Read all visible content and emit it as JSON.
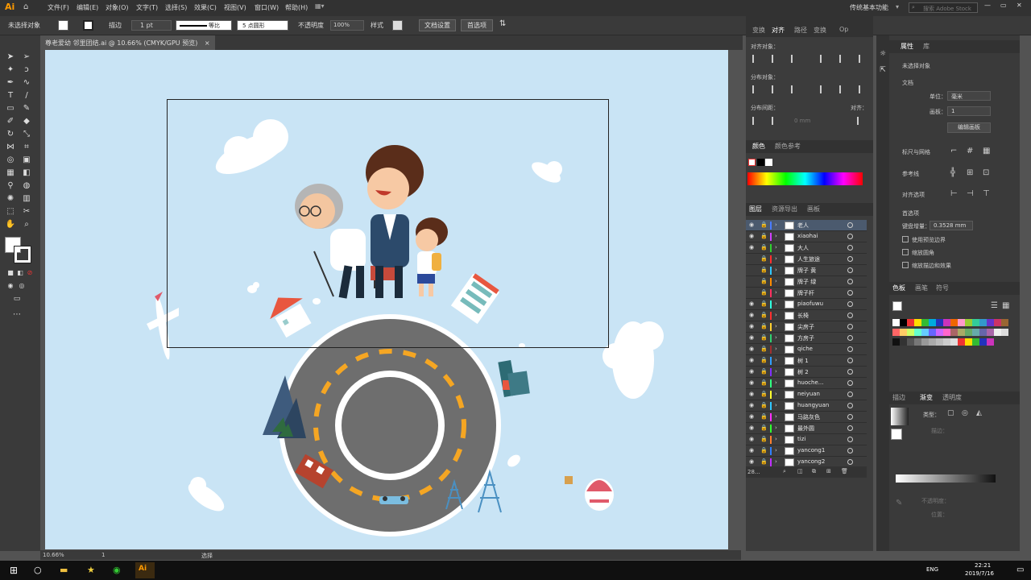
{
  "menubar": {
    "logo": "Ai",
    "items": [
      "文件(F)",
      "编辑(E)",
      "对象(O)",
      "文字(T)",
      "选择(S)",
      "效果(C)",
      "视图(V)",
      "窗口(W)",
      "帮助(H)"
    ],
    "workspace": "传统基本功能",
    "search_placeholder": "搜索 Adobe Stock"
  },
  "control": {
    "no_selection": "未选择对象",
    "stroke_label": "描边",
    "stroke_value": "1 pt",
    "uniform": "等比",
    "brush": "5 点圆形",
    "opacity_label": "不透明度",
    "opacity_value": "100%",
    "style_label": "样式",
    "doc_setup": "文档设置",
    "prefs": "首选项"
  },
  "document": {
    "tab": "尊老爱幼 邻里团结.ai @ 10.66% (CMYK/GPU 预览)",
    "close": "×"
  },
  "align_panel": {
    "tabs": [
      "变换",
      "对齐",
      "路径",
      "变换",
      "Op"
    ],
    "align_objects": "对齐对象：",
    "distribute_objects": "分布对象：",
    "distribute_spacing": "分布间距：",
    "align_to": "对齐：",
    "spacing_value": "0 mm"
  },
  "color_panel": {
    "tabs": [
      "颜色",
      "颜色参考"
    ]
  },
  "layers_panel": {
    "tabs": [
      "图层",
      "资源导出",
      "画板"
    ],
    "count": "28...",
    "layers": [
      {
        "name": "老人",
        "color": "#4a7cff",
        "visible": true
      },
      {
        "name": "xiaohai",
        "color": "#d040ff",
        "visible": true
      },
      {
        "name": "大人",
        "color": "#30d030",
        "visible": true
      },
      {
        "name": "人生旅途",
        "color": "#ff3030",
        "visible": false
      },
      {
        "name": "牌子 黄",
        "color": "#30c8ff",
        "visible": false
      },
      {
        "name": "牌子 绿",
        "color": "#ff8c00",
        "visible": false
      },
      {
        "name": "牌子杆",
        "color": "#ff3060",
        "visible": false
      },
      {
        "name": "piaofuwu",
        "color": "#30ffe0",
        "visible": true
      },
      {
        "name": "长椅",
        "color": "#ff3030",
        "visible": true
      },
      {
        "name": "尖房子",
        "color": "#ffd030",
        "visible": true
      },
      {
        "name": "方房子",
        "color": "#30d070",
        "visible": true
      },
      {
        "name": "qiche",
        "color": "#a03030",
        "visible": true
      },
      {
        "name": "树 1",
        "color": "#30a0ff",
        "visible": true
      },
      {
        "name": "树 2",
        "color": "#8030ff",
        "visible": true
      },
      {
        "name": "huoche...",
        "color": "#30ff80",
        "visible": true
      },
      {
        "name": "neiyuan",
        "color": "#ffff30",
        "visible": true
      },
      {
        "name": "huangyuan",
        "color": "#30c8ff",
        "visible": true
      },
      {
        "name": "马路灰色",
        "color": "#ff30ff",
        "visible": true
      },
      {
        "name": "最外圆",
        "color": "#30ff30",
        "visible": true
      },
      {
        "name": "tizi",
        "color": "#ff8030",
        "visible": true
      },
      {
        "name": "yancong1",
        "color": "#3080ff",
        "visible": true
      },
      {
        "name": "yancong2",
        "color": "#c030ff",
        "visible": true
      }
    ]
  },
  "properties": {
    "tabs": [
      "属性",
      "库"
    ],
    "no_selection": "未选择对象",
    "document": "文档",
    "units_label": "单位：",
    "units_value": "毫米",
    "artboard_label": "画板：",
    "artboard_value": "1",
    "edit_artboard": "编辑画板",
    "rulers": "标尺与网格",
    "guides": "参考线",
    "snap": "对齐选项",
    "prefs": "首选项",
    "keyboard_increment": "键盘增量：",
    "increment_value": "0.3528 mm",
    "opt1": "使用预览边界",
    "opt2": "缩放圆角",
    "opt3": "缩放描边和效果"
  },
  "swatch_panel": {
    "tabs": [
      "色板",
      "画笔",
      "符号"
    ]
  },
  "gradient_panel": {
    "tabs": [
      "描边",
      "渐变",
      "透明度"
    ],
    "type_label": "类型：",
    "stroke_label": "描边：",
    "opacity_label": "不透明度：",
    "position_label": "位置："
  },
  "statusbar": {
    "zoom": "10.66%",
    "artboard": "1",
    "tool": "选择"
  },
  "taskbar": {
    "lang": "ENG",
    "time": "22:21",
    "date": "2019/7/16"
  },
  "colors": {
    "canvas": "#c9e4f5",
    "road": "#6e6e6e",
    "dash": "#f5a623",
    "accent": "#ff9a00"
  }
}
